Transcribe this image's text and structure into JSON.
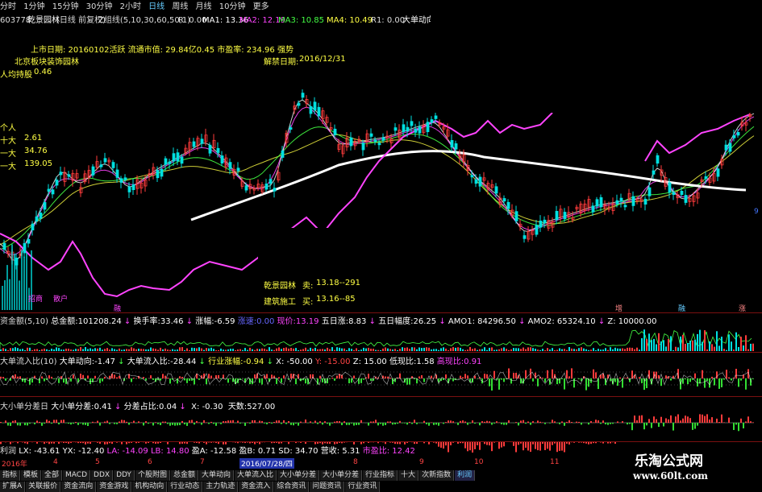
{
  "toolbar": {
    "items": [
      "分时",
      "1分钟",
      "15分钟",
      "30分钟",
      "2小时",
      "日线",
      "周线",
      "月线",
      "10分钟",
      "更多"
    ],
    "active": "日线"
  },
  "info": {
    "code": "603778",
    "name": "乾景园林",
    "mode": "(日线 前复权)",
    "ma_label": "Z组线(5,10,30,60,50,1)",
    "r": "R: 0.00",
    "ma1": "MA1: 13.36",
    "ma2": "MA2: 12.19",
    "ma3": "MA3: 10.85",
    "ma4": "MA4: 10.49",
    "r1": "R1: 0.00",
    "dadan": "大单动向"
  },
  "overlay": {
    "list_date": "上市日期: 20160102活跃 流通市值: 29.84亿0.45 市盈率: 234.96 强势",
    "sector": "北京板块装饰园林",
    "per_capita_label": "人均持股",
    "per_capita_value": "0.46",
    "unlock": "解禁日期:",
    "unlock_date": "2016/12/31",
    "ge_ren": "个人",
    "shi_da": "十大",
    "shi_da_v": "2.61",
    "yi_da": "一大",
    "yi_da_v": "34.76",
    "yi_da2": "一大",
    "yi_da2_v": "139.05",
    "sell_name": "乾景园林",
    "sell_label": "卖:",
    "sell_val": "13.18--291",
    "buy_name": "建筑施工",
    "buy_label": "买:",
    "buy_val": "13.16--85",
    "marks_bottom": [
      "增",
      "融",
      "涨"
    ],
    "left_small": [
      "招商",
      "散户"
    ],
    "bottom_flag": "融"
  },
  "ind1": {
    "name": "资金额(5,10)",
    "total_label": "总金额:",
    "total_val": "101208.24",
    "hs_label": "换手率:",
    "hs_val": "33.46",
    "zf_label": "涨幅:",
    "zf_val": "-6.59",
    "zs_label": "涨速:",
    "zs_val": "0.00",
    "xj_label": "现价:",
    "xj_val": "13.19",
    "wr_label": "五日涨:",
    "wr_val": "8.83",
    "wrfd_label": "五日幅度:",
    "wrfd_val": "26.25",
    "amo1": "AMO1: 84296.50",
    "amo2": "AMO2: 65324.10",
    "z": "Z: 10000.00"
  },
  "ind2": {
    "name": "大单流入比(10)",
    "a_label": "大单动向:",
    "a_val": "-1.47",
    "b_label": "大单流入比:",
    "b_val": "-28.44",
    "c_label": "行业涨幅:",
    "c_val": "-0.94",
    "x": "X: -50.00",
    "y": "Y: -15.00",
    "z": "Z: 15.00",
    "d_label": "低现比:",
    "d_val": "1.58",
    "e_label": "高现比:",
    "e_val": "0.91"
  },
  "ind3": {
    "name": "大小单分差日",
    "a_label": "大小单分差:",
    "a_val": "0.41",
    "b_label": "分差占比:",
    "b_val": "0.04",
    "x": "X: -0.30",
    "t_label": "天数:",
    "t_val": "527.00"
  },
  "ind4": {
    "name": "利润",
    "lx": "LX: -43.61",
    "yx": "YX: -12.40",
    "la": "LA: -14.09",
    "lb": "LB: 14.80",
    "ya": "盈A: -12.58",
    "yb": "盈B: 0.71",
    "sd": "SD: 34.70",
    "yc": "营收: 5.31",
    "sl": "市盈比: 12.42"
  },
  "axis": {
    "year": "2016年",
    "months": [
      "4",
      "5",
      "6",
      "7",
      "8",
      "9",
      "10",
      "11"
    ],
    "cursor": "2016/07/28/四"
  },
  "tabs1": [
    "指标",
    "模板",
    "全部",
    "MACD",
    "DDX",
    "DDY",
    "个股附图",
    "总金额",
    "大单动向",
    "大单流入比",
    "大小单分差",
    "大小单分差",
    "行业指标",
    "十大",
    "次新指数",
    "利润"
  ],
  "tabs2": [
    "扩展A",
    "关联报价",
    "资金流向",
    "资金游戏",
    "机构动向",
    "行业动态",
    "主力轨迹",
    "资金流入",
    "综合资讯",
    "问题资讯",
    "行业资讯"
  ],
  "right_labels": [
    "9"
  ],
  "logo": {
    "title": "乐淘公式网",
    "url": "www.60lt.com"
  },
  "colors": {
    "up": "#ff3b3b",
    "down": "#00e0e0",
    "ma1": "#ffffff",
    "ma2": "#ff44ff",
    "ma3": "#44ff44",
    "ma4": "#ffff44",
    "bg": "#000000",
    "grid": "#7a1010"
  }
}
